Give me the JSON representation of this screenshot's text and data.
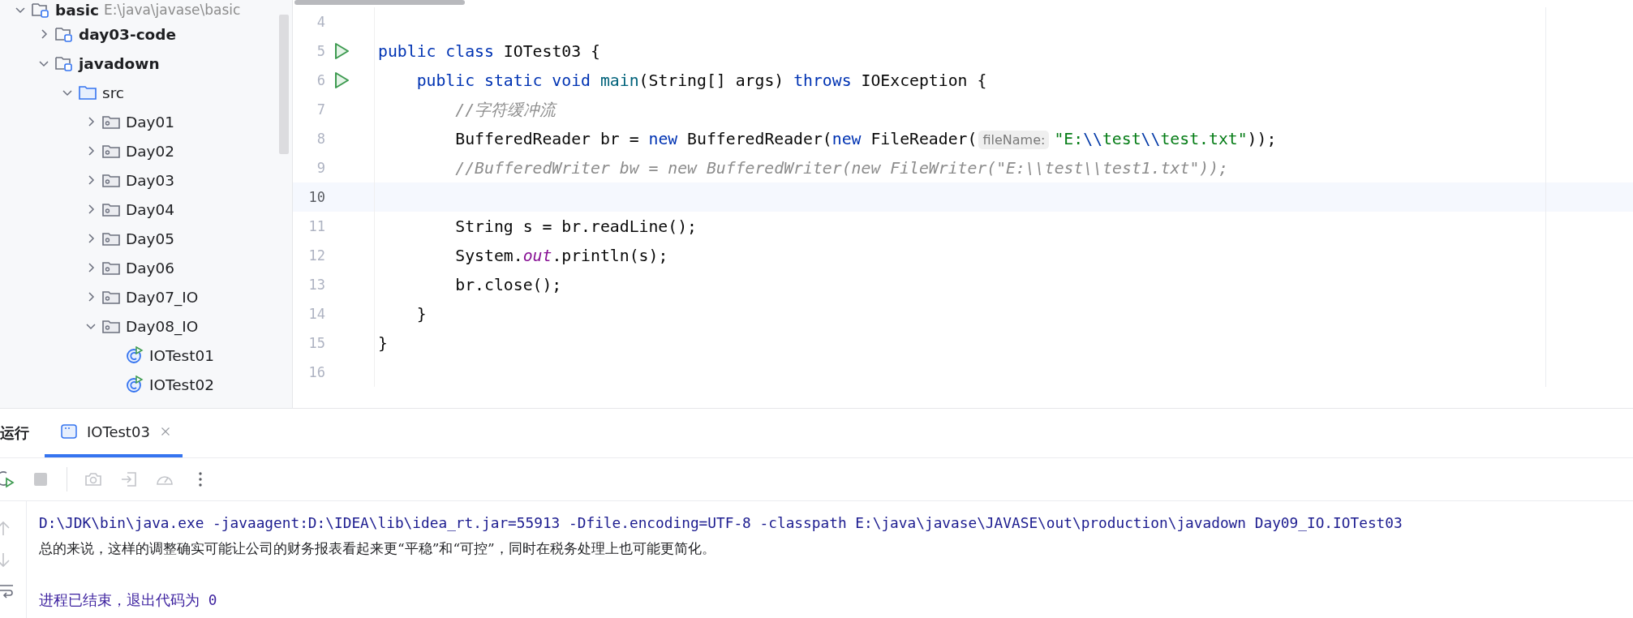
{
  "project_tree": [
    {
      "label": "basic",
      "path": "E:\\java\\javase\\basic",
      "kind": "module",
      "expanded": true,
      "children": [
        {
          "label": "day03-code",
          "kind": "module",
          "expanded": false
        },
        {
          "label": "javadown",
          "kind": "module",
          "expanded": true,
          "children": [
            {
              "label": "src",
              "kind": "source",
              "expanded": true,
              "children": [
                {
                  "label": "Day01",
                  "kind": "package",
                  "expanded": false
                },
                {
                  "label": "Day02",
                  "kind": "package",
                  "expanded": false
                },
                {
                  "label": "Day03",
                  "kind": "package",
                  "expanded": false
                },
                {
                  "label": "Day04",
                  "kind": "package",
                  "expanded": false
                },
                {
                  "label": "Day05",
                  "kind": "package",
                  "expanded": false
                },
                {
                  "label": "Day06",
                  "kind": "package",
                  "expanded": false
                },
                {
                  "label": "Day07_IO",
                  "kind": "package",
                  "expanded": false
                },
                {
                  "label": "Day08_IO",
                  "kind": "package",
                  "expanded": true,
                  "children": [
                    {
                      "label": "IOTest01",
                      "kind": "class"
                    },
                    {
                      "label": "IOTest02",
                      "kind": "class"
                    }
                  ]
                }
              ]
            }
          ]
        }
      ]
    }
  ],
  "editor": {
    "lines": [
      {
        "number": "4",
        "run": false,
        "current": false
      },
      {
        "number": "5",
        "run": true,
        "current": false,
        "tokens": [
          {
            "kind": "keyword",
            "text": "public class"
          },
          {
            "kind": "plain",
            "text": " IOTest03 {"
          }
        ]
      },
      {
        "number": "6",
        "run": true,
        "current": false,
        "tokens": [
          {
            "kind": "keyword",
            "text": "    public static void"
          },
          {
            "kind": "method",
            "text": " main"
          },
          {
            "kind": "plain",
            "text": "(String[] args) "
          },
          {
            "kind": "keyword",
            "text": "throws"
          },
          {
            "kind": "plain",
            "text": " IOException {"
          }
        ]
      },
      {
        "number": "7",
        "run": false,
        "current": false,
        "tokens": [
          {
            "kind": "comment",
            "text": "        //字符缓冲流"
          }
        ]
      },
      {
        "number": "8",
        "run": false,
        "current": false,
        "tokens": [
          {
            "kind": "plain",
            "text": "        BufferedReader br = "
          },
          {
            "kind": "keyword",
            "text": "new"
          },
          {
            "kind": "plain",
            "text": " BufferedReader("
          },
          {
            "kind": "keyword",
            "text": "new"
          },
          {
            "kind": "plain",
            "text": " FileReader("
          },
          {
            "kind": "hint",
            "text": "fileName:"
          },
          {
            "kind": "string",
            "text": "\"E:"
          },
          {
            "kind": "escape",
            "text": "\\\\"
          },
          {
            "kind": "string",
            "text": "test"
          },
          {
            "kind": "escape",
            "text": "\\\\"
          },
          {
            "kind": "string",
            "text": "test.txt\""
          },
          {
            "kind": "plain",
            "text": "));"
          }
        ]
      },
      {
        "number": "9",
        "run": false,
        "current": false,
        "tokens": [
          {
            "kind": "comment",
            "text": "        //BufferedWriter bw = new BufferedWriter(new FileWriter(\"E:\\\\test\\\\test1.txt\"));"
          }
        ]
      },
      {
        "number": "10",
        "run": false,
        "current": true
      },
      {
        "number": "11",
        "run": false,
        "current": false,
        "tokens": [
          {
            "kind": "plain",
            "text": "        String s = br.readLine();"
          }
        ]
      },
      {
        "number": "12",
        "run": false,
        "current": false,
        "tokens": [
          {
            "kind": "plain",
            "text": "        System."
          },
          {
            "kind": "field",
            "text": "out"
          },
          {
            "kind": "plain",
            "text": ".println(s);"
          }
        ]
      },
      {
        "number": "13",
        "run": false,
        "current": false,
        "tokens": [
          {
            "kind": "plain",
            "text": "        br.close();"
          }
        ]
      },
      {
        "number": "14",
        "run": false,
        "current": false,
        "tokens": [
          {
            "kind": "plain",
            "text": "    }"
          }
        ]
      },
      {
        "number": "15",
        "run": false,
        "current": false,
        "tokens": [
          {
            "kind": "plain",
            "text": "}"
          }
        ]
      },
      {
        "number": "16",
        "run": false,
        "current": false
      }
    ]
  },
  "run_panel": {
    "title": "运行",
    "tabs": [
      {
        "label": "IOTest03",
        "selected": true
      }
    ],
    "console": [
      {
        "kind": "command",
        "text": "D:\\JDK\\bin\\java.exe -javaagent:D:\\IDEA\\lib\\idea_rt.jar=55913 -Dfile.encoding=UTF-8 -classpath E:\\java\\javase\\JAVASE\\out\\production\\javadown Day09_IO.IOTest03"
      },
      {
        "kind": "output",
        "text": "总的来说，这样的调整确实可能让公司的财务报表看起来更“平稳”和“可控”，同时在税务处理上也可能更简化。"
      },
      {
        "kind": "blank"
      },
      {
        "kind": "system",
        "text": "进程已结束，退出代码为 0"
      }
    ]
  }
}
